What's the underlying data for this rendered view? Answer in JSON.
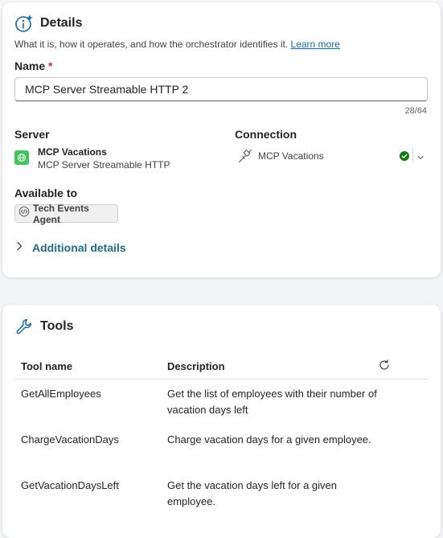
{
  "details": {
    "title": "Details",
    "subtitle": "What it is, how it operates, and how the orchestrator identifies it.",
    "learn_more": "Learn more",
    "name_label": "Name",
    "required_mark": "*",
    "name_value": "MCP Server Streamable HTTP 2",
    "name_counter": "28/64",
    "server_label": "Server",
    "server_name": "MCP Vacations",
    "server_type": "MCP Server Streamable HTTP",
    "connection_label": "Connection",
    "connection_name": "MCP Vacations",
    "available_label": "Available to",
    "agent_chip": "Tech Events Agent",
    "additional_details": "Additional details"
  },
  "tools": {
    "title": "Tools",
    "columns": [
      "Tool name",
      "Description"
    ],
    "rows": [
      {
        "name": "GetAllEmployees",
        "description": "Get the list of employees with their number of vacation days left"
      },
      {
        "name": "ChargeVacationDays",
        "description": "Charge vacation days for a given employee."
      },
      {
        "name": "GetVacationDaysLeft",
        "description": "Get the vacation days left for a given employee."
      }
    ]
  },
  "colors": {
    "accent": "#0f6cbd",
    "success": "#107c10",
    "server_icon": "#3ec65a",
    "link_teal": "#1f6f8b"
  },
  "icons": [
    "info-sparkle-icon",
    "globe-icon",
    "plug-icon",
    "check-circle-icon",
    "chevron-down-icon",
    "code-icon",
    "chevron-right-icon",
    "wrench-icon",
    "refresh-icon"
  ]
}
